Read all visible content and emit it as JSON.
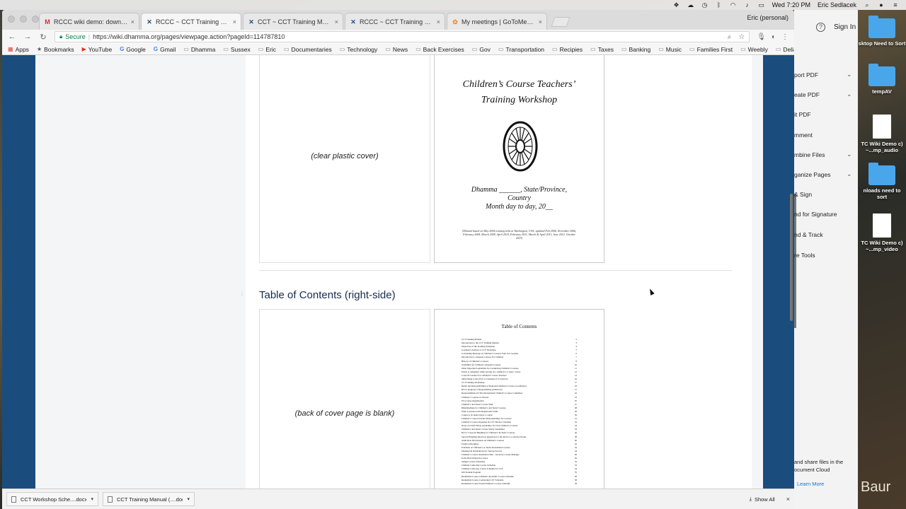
{
  "menubar": {
    "time": "Wed 7:20 PM",
    "user": "Eric Sedlacek"
  },
  "browser": {
    "profile": "Eric (personal)",
    "tabs": [
      {
        "title": "RCCC wiki demo: downloading",
        "icon": "gmail-icon"
      },
      {
        "title": "RCCC ~ CCT Training Manual",
        "icon": "confluence-icon"
      },
      {
        "title": "CCT ~ CCT Training Manual (F",
        "icon": "confluence-icon"
      },
      {
        "title": "RCCC ~ CCT Training Worksho",
        "icon": "confluence-icon"
      },
      {
        "title": "My meetings | GoToMeeting",
        "icon": "gotomeeting-icon"
      }
    ],
    "secure_label": "Secure",
    "url": "https://wiki.dhamma.org/pages/viewpage.action?pageId=114787810",
    "bookmarks": [
      {
        "label": "Apps",
        "icon": "apps-icon"
      },
      {
        "label": "Bookmarks",
        "icon": "star-icon"
      },
      {
        "label": "YouTube",
        "icon": "youtube-icon"
      },
      {
        "label": "Google",
        "icon": "google-icon"
      },
      {
        "label": "Gmail",
        "icon": "google-icon"
      },
      {
        "label": "Dhamma",
        "icon": "folder-icon"
      },
      {
        "label": "Sussex",
        "icon": "folder-icon"
      },
      {
        "label": "Eric",
        "icon": "folder-icon"
      },
      {
        "label": "Documentaries",
        "icon": "folder-icon"
      },
      {
        "label": "Technology",
        "icon": "folder-icon"
      },
      {
        "label": "News",
        "icon": "folder-icon"
      },
      {
        "label": "Back Exercises",
        "icon": "folder-icon"
      },
      {
        "label": "Gov",
        "icon": "folder-icon"
      },
      {
        "label": "Transportation",
        "icon": "folder-icon"
      },
      {
        "label": "Recipies",
        "icon": "folder-icon"
      },
      {
        "label": "Taxes",
        "icon": "folder-icon"
      },
      {
        "label": "Banking",
        "icon": "folder-icon"
      },
      {
        "label": "Music",
        "icon": "folder-icon"
      },
      {
        "label": "Families First",
        "icon": "folder-icon"
      },
      {
        "label": "Weebly",
        "icon": "folder-icon"
      },
      {
        "label": "Delia",
        "icon": "folder-icon"
      }
    ],
    "bookmarks_overflow": "»"
  },
  "page": {
    "cover_left_label": "(clear plastic cover)",
    "cover_title_line1": "Children’s Course Teachers’",
    "cover_title_line2": "Training Workshop",
    "cover_loc_line1": "Dhamma ______, State/Province,",
    "cover_loc_line2": "Country",
    "cover_loc_line3": "Month day to day, 20__",
    "cover_note": "[Manual based on May 2004 training held at Washington, USA; updated Feb 2006, November 2006, February 2008, March 2009, April 2010, February 2011, March & April 2011, June 2012, October 2015]",
    "section_heading": "Table of Contents (right-side)",
    "toc_left_label": "(back of cover page is blank)",
    "toc_title": "Table of Contents",
    "toc_entries": [
      {
        "t": "CCT Training Manual",
        "p": "2"
      },
      {
        "t": "Introduction to the CCT Training Manual",
        "p": "3"
      },
      {
        "t": "Objectives of the Training Workshop",
        "p": "4"
      },
      {
        "t": "Goenkaji’s Address at CCT Workshop",
        "p": "5"
      },
      {
        "t": "Concluding Message on Children’s Courses from S.N. Goenka",
        "p": "6"
      },
      {
        "t": "Introduction to Anapana Courses For Children",
        "p": "7"
      },
      {
        "t": "History of Children’s Courses",
        "p": "8"
      },
      {
        "t": "Guidelines for Children’s Anapana Courses",
        "p": "10"
      },
      {
        "t": "Other Important Guidelines for Conducting Children’s Courses",
        "p": "11"
      },
      {
        "t": "Points to remember while serving on a children’s or teens’ course",
        "p": "12"
      },
      {
        "t": "Code Of Conduct For Children’s Course Teachers",
        "p": "13"
      },
      {
        "t": "Subscribing to the USA or Canadian CCT Listservs",
        "p": "16"
      },
      {
        "t": "CCT Training Workshops",
        "p": "17"
      },
      {
        "t": "Duties and Responsibilities of Regional Children’s Course Coordinators",
        "p": "18"
      },
      {
        "t": "RCCC Regions of Responsibility (Americas)",
        "p": "21"
      },
      {
        "t": "Responsibilities Of The International Children’s Course Committee",
        "p": "22"
      },
      {
        "t": "Children’s Courses at Schools",
        "p": "23"
      },
      {
        "t": "Pre-Course Organization",
        "p": "25"
      },
      {
        "t": "Children’s and Teens’ Course Wiki",
        "p": "27"
      },
      {
        "t": "Dhammadhaja for Children’s and Teens’ Courses",
        "p": "28"
      },
      {
        "t": "What is needed at the Registration Table",
        "p": "29"
      },
      {
        "t": "Copies to be made before a course",
        "p": "30"
      },
      {
        "t": "Children’s Course Teacher Responsibilities for Courses",
        "p": "31"
      },
      {
        "t": "Children’s Course Organizer & CCT Review Checklist",
        "p": "32"
      },
      {
        "t": "Notes on Child Safety Guidelines for USA Children’s Courses",
        "p": "33"
      },
      {
        "t": "Children’s and Teens’ Course Safety Guidelines",
        "p": "34"
      },
      {
        "t": "RCCC’s Special Handling for Children’s & Teens’ Courses",
        "p": "36"
      },
      {
        "t": "Special Handling Interview Questions for the RCCCs to ask the Parents",
        "p": "38"
      },
      {
        "t": "Adult Role Descriptions on Children’s Courses",
        "p": "40"
      },
      {
        "t": "Positive Discipline",
        "p": "42"
      },
      {
        "t": "Problems on Children’s or Teens’ Residential Courses",
        "p": "43"
      },
      {
        "t": "Meetings & Orientations for Various Servers",
        "p": "44"
      },
      {
        "t": "Children’s Course Orientation Talk – Given by Course Manager",
        "p": "49"
      },
      {
        "t": "In the Hall during the Course",
        "p": "50"
      },
      {
        "t": "Sample Course Schedules",
        "p": "52"
      },
      {
        "t": "   Children’s One-Day Course Schedule",
        "p": "53"
      },
      {
        "t": "   Children’s One-day Course Schedule for CCT",
        "p": "54"
      },
      {
        "t": "   Old Student Program",
        "p": "55"
      },
      {
        "t": "   Residential Course Children’s & Adults’ Course Schedule",
        "p": "56"
      },
      {
        "t": "   Residential Course Conducting CCT Schedule",
        "p": "58"
      },
      {
        "t": "   Residential Course Teens/Children’s Course Schedule",
        "p": "59"
      }
    ]
  },
  "downloads": {
    "items": [
      {
        "name": "CCT Workshop Sche....docx"
      },
      {
        "name": "CCT Training Manual (....doc"
      }
    ],
    "show_all": "Show All"
  },
  "acrobat": {
    "sign_in": "Sign In",
    "tools": [
      {
        "label": "port PDF",
        "chevron": true
      },
      {
        "label": "eate PDF",
        "chevron": true
      },
      {
        "label": "it PDF",
        "chevron": false
      },
      {
        "label": "mment",
        "chevron": false
      },
      {
        "label": "mbine Files",
        "chevron": true
      },
      {
        "label": "ganize Pages",
        "chevron": true
      },
      {
        "label": "& Sign",
        "chevron": false
      },
      {
        "label": "nd for Signature",
        "chevron": false
      },
      {
        "label": "nd & Track",
        "chevron": false
      },
      {
        "label": "re Tools",
        "chevron": false
      }
    ],
    "footer_line1": "and share files in the",
    "footer_line2": "ocument Cloud",
    "learn_more": "Learn More"
  },
  "desktop": {
    "items": [
      {
        "kind": "folder",
        "label": "sktop Need to Sort"
      },
      {
        "kind": "folder",
        "label": "tempAV"
      },
      {
        "kind": "file",
        "label": "TC Wiki Demo c) ~...mp_audio"
      },
      {
        "kind": "folder",
        "label": "nloads need to sort"
      },
      {
        "kind": "file",
        "label": "TC Wiki Demo c) ~...mp_video"
      }
    ],
    "watermark": "Baur"
  }
}
